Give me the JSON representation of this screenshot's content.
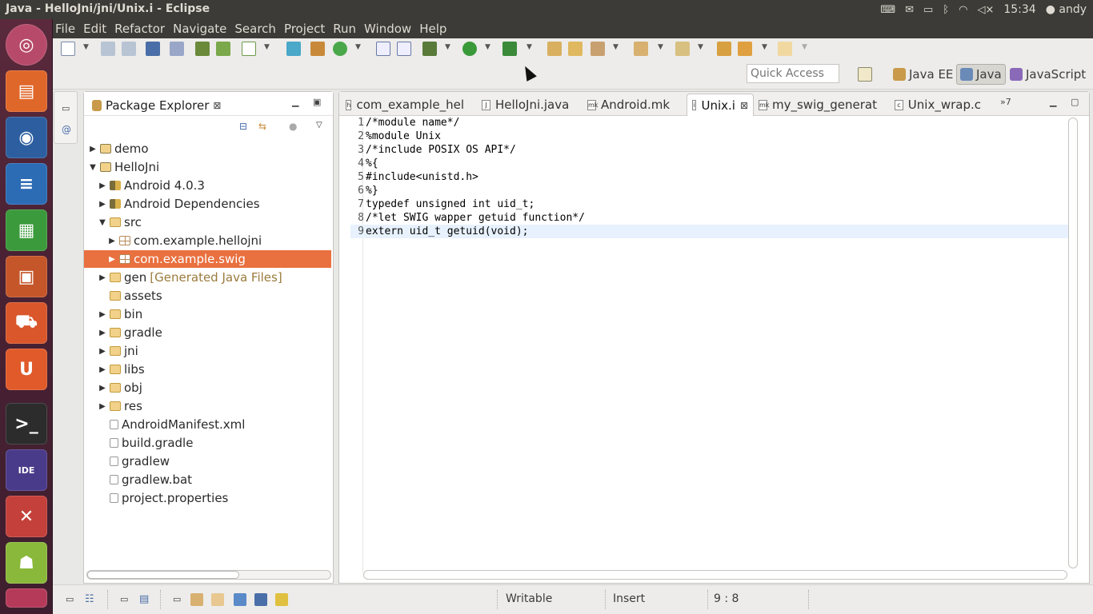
{
  "window": {
    "title": "Java - HelloJni/jni/Unix.i - Eclipse"
  },
  "tray": {
    "time": "15:34",
    "user": "andy"
  },
  "menubar": [
    "File",
    "Edit",
    "Refactor",
    "Navigate",
    "Search",
    "Project",
    "Run",
    "Window",
    "Help"
  ],
  "toolbar": {
    "quick_access_placeholder": "Quick Access"
  },
  "perspectives": [
    "Java EE",
    "Java",
    "JavaScript"
  ],
  "package_explorer": {
    "title": "Package Explorer",
    "tree": [
      {
        "label": "demo",
        "expanded": false,
        "icon": "project-icon"
      },
      {
        "label": "HelloJni",
        "expanded": true,
        "icon": "project-icon"
      },
      {
        "label": "Android 4.0.3",
        "expanded": false,
        "icon": "library-icon"
      },
      {
        "label": "Android Dependencies",
        "expanded": false,
        "icon": "library-icon"
      },
      {
        "label": "src",
        "expanded": true,
        "icon": "source-folder-icon"
      },
      {
        "label": "com.example.hellojni",
        "expanded": false,
        "icon": "package-icon"
      },
      {
        "label": "com.example.swig",
        "expanded": false,
        "icon": "package-icon",
        "selected": true
      },
      {
        "label": "gen",
        "decoration": "[Generated Java Files]",
        "expanded": false,
        "icon": "source-folder-icon"
      },
      {
        "label": "assets",
        "icon": "folder-icon"
      },
      {
        "label": "bin",
        "expanded": false,
        "icon": "folder-icon"
      },
      {
        "label": "gradle",
        "expanded": false,
        "icon": "folder-icon"
      },
      {
        "label": "jni",
        "expanded": false,
        "icon": "folder-icon"
      },
      {
        "label": "libs",
        "expanded": false,
        "icon": "folder-icon"
      },
      {
        "label": "obj",
        "expanded": false,
        "icon": "folder-icon"
      },
      {
        "label": "res",
        "expanded": false,
        "icon": "folder-icon"
      },
      {
        "label": "AndroidManifest.xml",
        "icon": "xml-file-icon"
      },
      {
        "label": "build.gradle",
        "icon": "file-icon"
      },
      {
        "label": "gradlew",
        "icon": "file-icon"
      },
      {
        "label": "gradlew.bat",
        "icon": "file-icon"
      },
      {
        "label": "project.properties",
        "icon": "file-icon"
      }
    ]
  },
  "editor": {
    "tabs": [
      {
        "label": "com_example_hel",
        "icon": "h"
      },
      {
        "label": "HelloJni.java",
        "icon": "J"
      },
      {
        "label": "Android.mk",
        "icon": "mk"
      },
      {
        "label": "Unix.i",
        "icon": "i",
        "active": true
      },
      {
        "label": "my_swig_generat",
        "icon": "mk"
      },
      {
        "label": "Unix_wrap.c",
        "icon": "c"
      }
    ],
    "overflow_label": "»7",
    "lines": [
      "/*module name*/",
      "%module Unix",
      "/*include POSIX OS API*/",
      "%{",
      "#include<unistd.h>",
      "%}",
      "typedef unsigned int uid_t;",
      "/*let SWIG wapper getuid function*/",
      "extern uid_t getuid(void);"
    ],
    "current_line": 9
  },
  "status": {
    "writable": "Writable",
    "insert_mode": "Insert",
    "position": "9 : 8"
  }
}
